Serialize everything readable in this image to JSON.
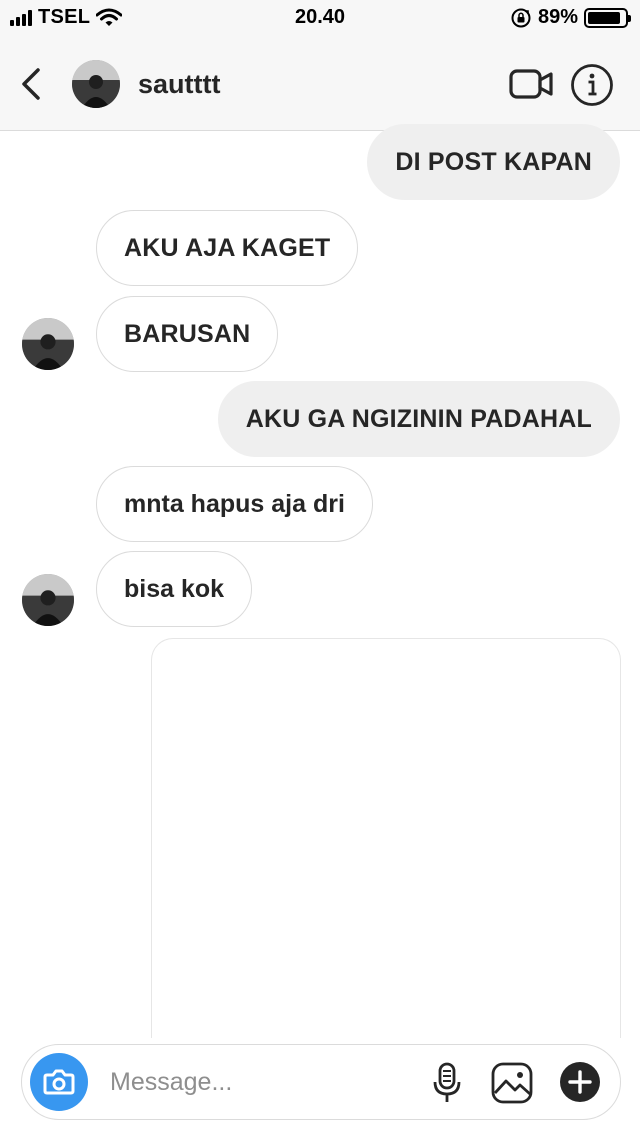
{
  "status_bar": {
    "carrier": "TSEL",
    "time": "20.40",
    "battery_percent": "89%",
    "battery_level": 0.89,
    "icons": [
      "signal-icon",
      "wifi-icon",
      "orientation-lock-icon",
      "battery-icon"
    ]
  },
  "header": {
    "username": "sautttt",
    "icons": [
      "back-chevron-icon",
      "avatar",
      "video-call-icon",
      "info-icon"
    ]
  },
  "messages": [
    {
      "text": "DI POST KAPAN",
      "direction": "sent"
    },
    {
      "text": "AKU AJA KAGET",
      "direction": "received"
    },
    {
      "text": "BARUSAN",
      "direction": "received"
    },
    {
      "text": "AKU GA NGIZININ PADAHAL",
      "direction": "sent"
    },
    {
      "text": "mnta hapus aja dri",
      "direction": "received"
    },
    {
      "text": "bisa kok",
      "direction": "received"
    }
  ],
  "composer": {
    "placeholder": "Message...",
    "icons": [
      "camera-icon",
      "microphone-icon",
      "gallery-icon",
      "plus-icon"
    ]
  },
  "colors": {
    "accent": "#3897f0",
    "sent_bubble": "#efefef",
    "received_border": "#dbdbdb",
    "text": "#262626",
    "placeholder": "#8e8e8e"
  }
}
